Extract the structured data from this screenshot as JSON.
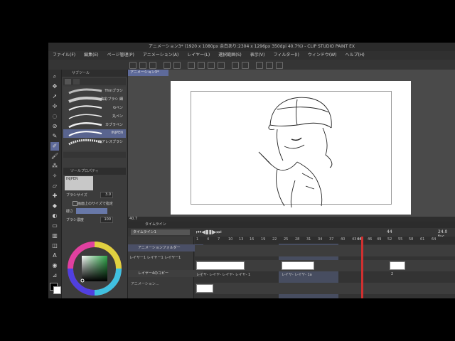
{
  "window": {
    "title": "アニメーション3* (1920 x 1080px 余白あり:2304 x 1296px 350dpi 40.7%)  - CLIP STUDIO PAINT EX"
  },
  "menu": [
    "ファイル(F)",
    "編集(E)",
    "ページ管理(P)",
    "アニメーション(A)",
    "レイヤー(L)",
    "選択範囲(S)",
    "表示(V)",
    "フィルター(I)",
    "ウィンドウ(W)",
    "ヘルプ(H)"
  ],
  "subtool": {
    "header": "サブツール",
    "brushes": [
      {
        "name": "Thinブラシ",
        "selected": false
      },
      {
        "name": "油彩ブラシ 細",
        "selected": false
      },
      {
        "name": "Gペン",
        "selected": false
      },
      {
        "name": "丸ペン",
        "selected": false
      },
      {
        "name": "カブラペン",
        "selected": false
      },
      {
        "name": "INJPEN",
        "selected": true
      },
      {
        "name": "エアレスブラシ",
        "selected": false
      }
    ]
  },
  "tool_property": {
    "header": "ツールプロパティ",
    "brush_name": "INJPEN",
    "brush_size_label": "ブラシサイズ",
    "brush_size_value": "3.0",
    "screen_size_label": "画面上のサイズで指定",
    "hardness_label": "硬さ",
    "density_label": "ブラシ濃度",
    "density_value": "100"
  },
  "canvas": {
    "tab_label": "アニメーション3*",
    "zoom": "40.7"
  },
  "timeline": {
    "header": "タイムライン",
    "name": "タイムライン1",
    "current_frame": "44",
    "fps": "24.0 fps",
    "ruler": [
      "1",
      "4",
      "7",
      "10",
      "13",
      "16",
      "19",
      "22",
      "25",
      "28",
      "31",
      "34",
      "37",
      "40",
      "43",
      "44",
      "46",
      "49",
      "52",
      "55",
      "58",
      "61",
      "64"
    ],
    "layer1_label": "アニメーションフォルダー",
    "layer1_cells": "レイヤー1 レイヤー1 レイヤー1",
    "layer1_track_text": "レイヤ- レイヤ- レイヤ- レイヤ- 1",
    "layer1_track_text2": "レイヤ- レイヤ- 1a",
    "layer1_track_num": "2",
    "layer2_label": "レイヤー4のコピー",
    "bottom_label": "アニメーション..."
  },
  "colors": {
    "accent": "#5e6a9a",
    "panel": "#3a3a3a",
    "playhead": "#d03030"
  }
}
